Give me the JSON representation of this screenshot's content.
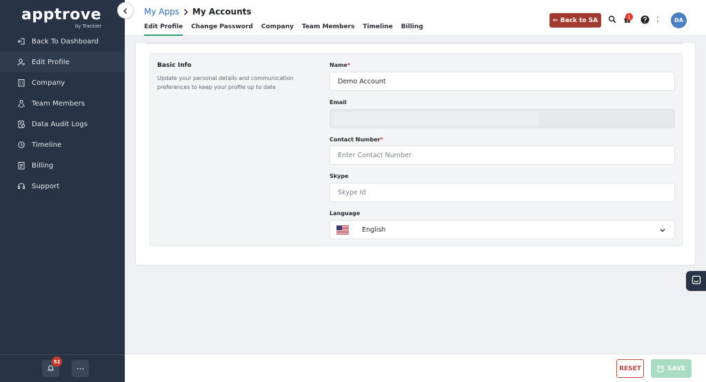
{
  "logo": {
    "name": "apptrove",
    "tagline": "by Trackier"
  },
  "sidebar": {
    "items": [
      {
        "label": "Back To Dashboard",
        "icon": "back-icon",
        "active": false
      },
      {
        "label": "Edit Profile",
        "icon": "user-edit-icon",
        "active": true
      },
      {
        "label": "Company",
        "icon": "building-icon",
        "active": false
      },
      {
        "label": "Team Members",
        "icon": "team-icon",
        "active": false
      },
      {
        "label": "Data Audit Logs",
        "icon": "audit-log-icon",
        "active": false
      },
      {
        "label": "Timeline",
        "icon": "timeline-icon",
        "active": false
      },
      {
        "label": "Billing",
        "icon": "billing-icon",
        "active": false
      },
      {
        "label": "Support",
        "icon": "support-icon",
        "active": false
      }
    ],
    "notifications_count": "52",
    "more_label": "···"
  },
  "header": {
    "breadcrumb_root": "My Apps",
    "breadcrumb_current": "My Accounts",
    "tabs": [
      {
        "label": "Edit Profile",
        "active": true
      },
      {
        "label": "Change Password",
        "active": false
      },
      {
        "label": "Company",
        "active": false
      },
      {
        "label": "Team Members",
        "active": false
      },
      {
        "label": "Timeline",
        "active": false
      },
      {
        "label": "Billing",
        "active": false
      }
    ],
    "back_button": "← Back to SA",
    "gift_badge": "1",
    "avatar_initials": "DA"
  },
  "form": {
    "section_title": "Basic Info",
    "section_description": "Update your personal details and communication preferences to keep your profile up to date",
    "name_label": "Name",
    "name_value": "Demo Account",
    "email_label": "Email",
    "contact_label": "Contact Number",
    "contact_placeholder": "Enter Contact Number",
    "skype_label": "Skype",
    "skype_placeholder": "Skype Id",
    "language_label": "Language",
    "language_value": "English",
    "required_mark": "*"
  },
  "footer": {
    "reset_label": "RESET",
    "save_label": "SAVE"
  },
  "colors": {
    "sidebar_bg": "#283446",
    "accent_green": "#2d9e6a",
    "back_button": "#a13a2e",
    "link_blue": "#2b6cb0"
  }
}
